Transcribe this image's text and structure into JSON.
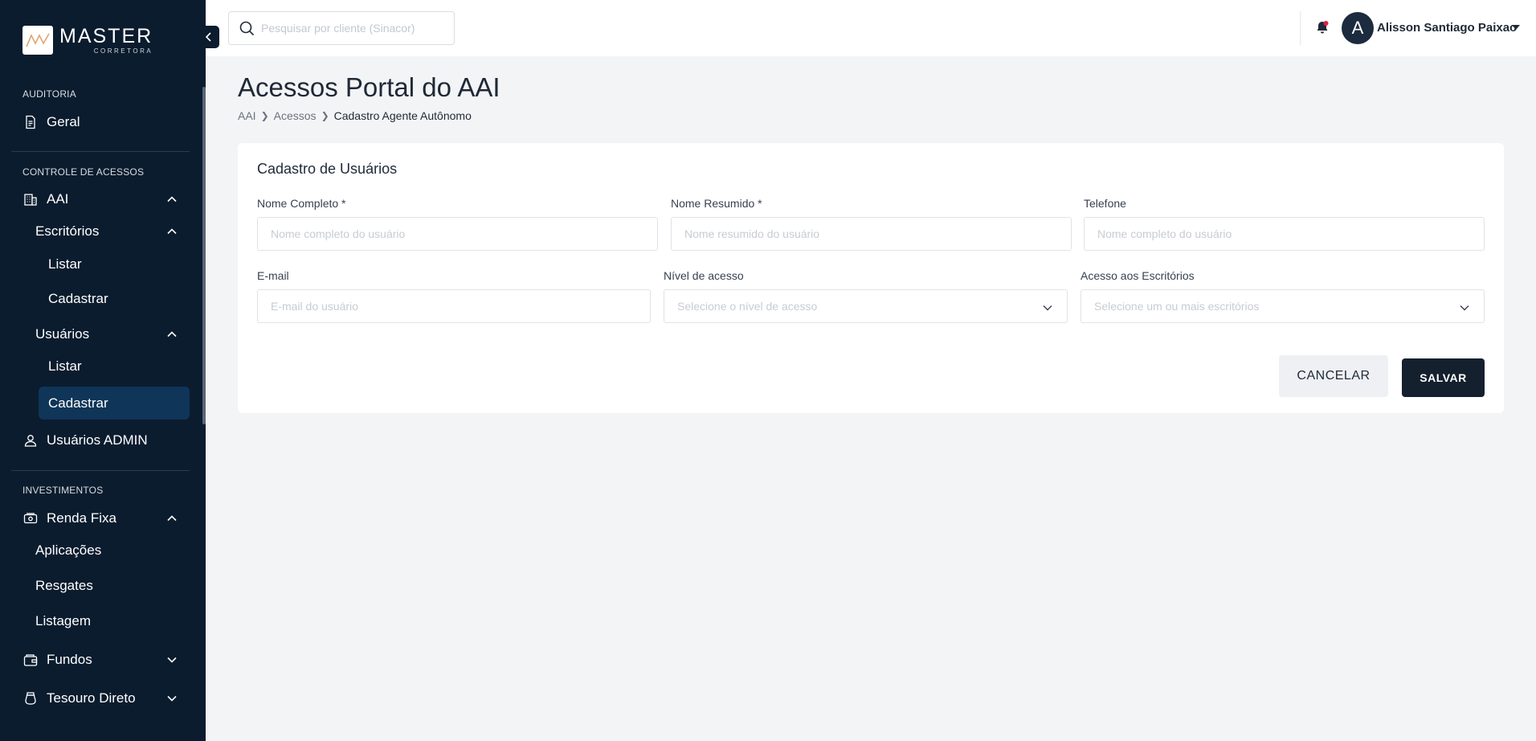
{
  "brand": {
    "name": "MASTER",
    "tagline": "CORRETORA"
  },
  "sidebar": {
    "sections": [
      {
        "title": "AUDITORIA"
      },
      {
        "title": "CONTROLE DE ACESSOS"
      },
      {
        "title": "INVESTIMENTOS"
      }
    ],
    "items": {
      "geral": "Geral",
      "aai": "AAI",
      "escritorios": "Escritórios",
      "escritorios_listar": "Listar",
      "escritorios_cadastrar": "Cadastrar",
      "usuarios": "Usuários",
      "usuarios_listar": "Listar",
      "usuarios_cadastrar": "Cadastrar",
      "usuarios_admin": "Usuários ADMIN",
      "renda_fixa": "Renda Fixa",
      "aplicacoes": "Aplicações",
      "resgates": "Resgates",
      "listagem": "Listagem",
      "fundos": "Fundos",
      "tesouro_direto": "Tesouro Direto"
    },
    "active_item": "usuarios_cadastrar"
  },
  "header": {
    "search_placeholder": "Pesquisar por cliente (Sinacor)",
    "user": {
      "initial": "A",
      "name": "Alisson Santiago Paixao"
    }
  },
  "page": {
    "title": "Acessos Portal do AAI",
    "breadcrumb": [
      "AAI",
      "Acessos",
      "Cadastro Agente Autônomo"
    ]
  },
  "form": {
    "title": "Cadastro de Usuários",
    "fields": {
      "nome_completo": {
        "label": "Nome Completo *",
        "placeholder": "Nome completo do usuário",
        "value": ""
      },
      "nome_resumido": {
        "label": "Nome Resumido *",
        "placeholder": "Nome resumido do usuário",
        "value": ""
      },
      "telefone": {
        "label": "Telefone",
        "placeholder": "Nome completo do usuário",
        "value": ""
      },
      "email": {
        "label": "E-mail",
        "placeholder": "E-mail do usuário",
        "value": ""
      },
      "nivel_acesso": {
        "label": "Nível de acesso",
        "placeholder": "Selecione o nível de acesso"
      },
      "acesso_escritorios": {
        "label": "Acesso aos Escritórios",
        "placeholder": "Selecione um ou mais escritórios"
      }
    },
    "buttons": {
      "cancel": "CANCELAR",
      "save": "SALVAR"
    }
  },
  "colors": {
    "sidebar_bg": "#0b1c2e",
    "sidebar_active": "#0f3558",
    "primary_button": "#15202e",
    "page_bg": "#f3f4f6",
    "logo_accent": "#e0a56a",
    "notification_dot": "#e11d48"
  },
  "icons": {
    "logo": "master-logo-icon",
    "collapse": "chevron-left-icon",
    "search": "search-icon",
    "bell": "bell-icon",
    "user_menu": "caret-down-icon"
  }
}
